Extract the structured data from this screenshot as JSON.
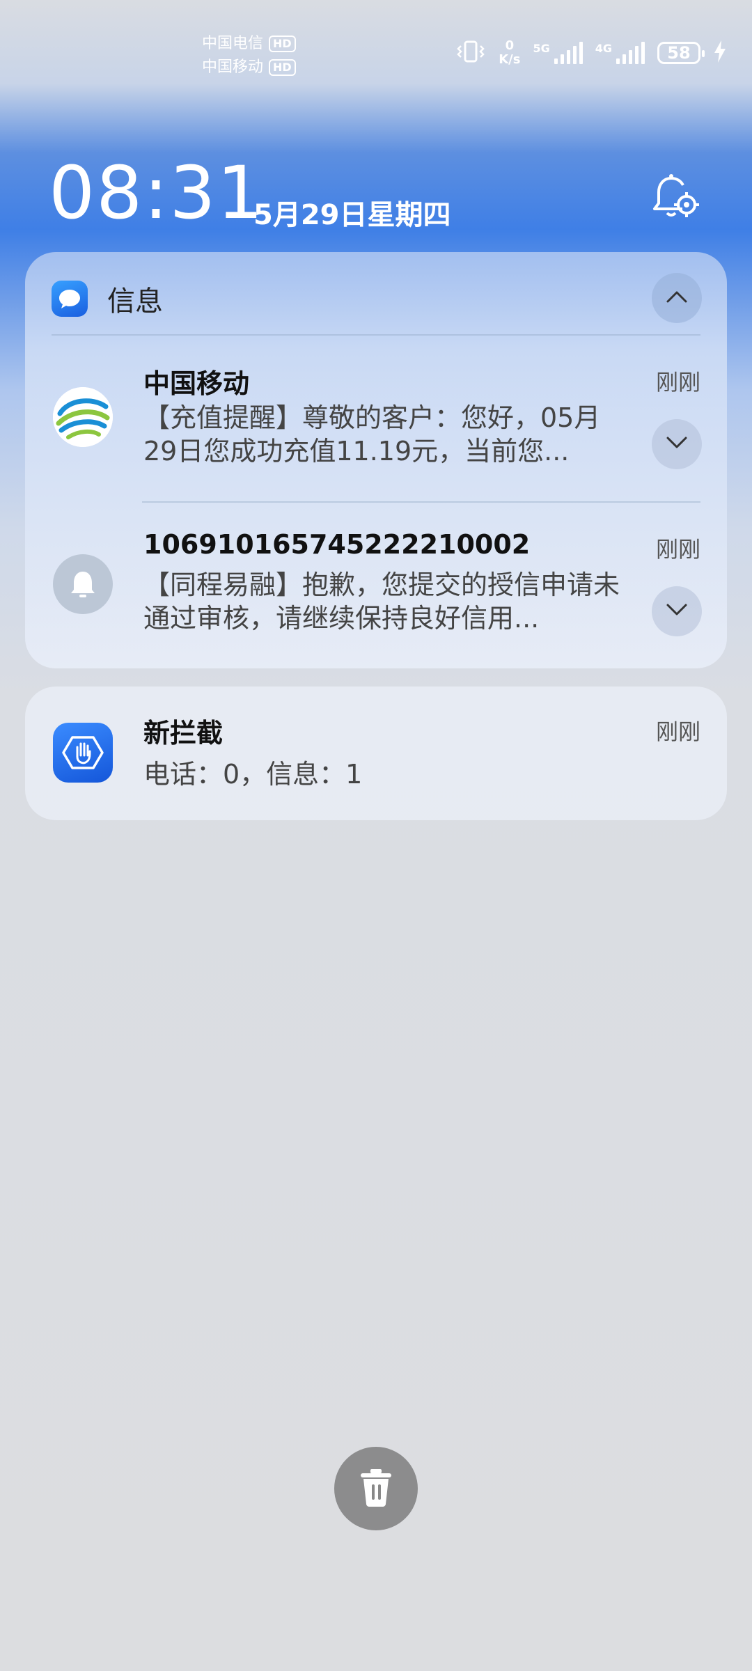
{
  "status_bar": {
    "carrier1": "中国电信",
    "carrier2": "中国移动",
    "hd_label": "HD",
    "speed_value": "0",
    "speed_unit": "K/s",
    "sim1_net": "5G",
    "sim2_net": "4G",
    "battery_level": "58",
    "icons": [
      "vibrate-icon",
      "signal-5g-icon",
      "signal-4g-icon",
      "battery-icon",
      "charging-icon"
    ]
  },
  "lockscreen": {
    "time": "08:31",
    "date": "5月29日星期四"
  },
  "messages_group": {
    "app_name": "信息",
    "items": [
      {
        "sender": "中国移动",
        "time": "刚刚",
        "body": "【充值提醒】尊敬的客户：您好，05月29日您成功充值11.19元，当前您..."
      },
      {
        "sender": "106910165745222210002",
        "time": "刚刚",
        "body": "【同程易融】抱歉，您提交的授信申请未通过审核，请继续保持良好信用..."
      }
    ]
  },
  "blocked_card": {
    "title": "新拦截",
    "time": "刚刚",
    "body": "电话：0，信息：1"
  },
  "colors": {
    "accent": "#3f7fe6",
    "cmcc_blue": "#1a8fd6",
    "cmcc_green": "#8cc63f"
  }
}
